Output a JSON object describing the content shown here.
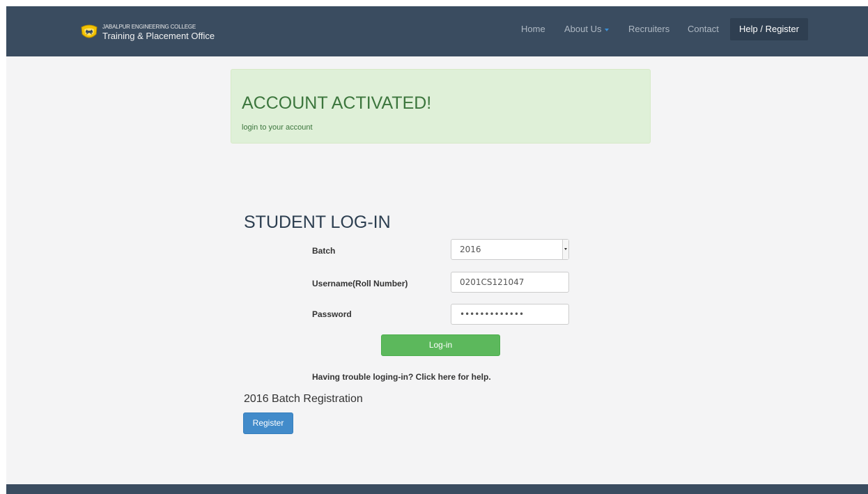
{
  "header": {
    "brand_line1": "JABALPUR ENGINEERING COLLEGE",
    "brand_line2": "Training & Placement Office",
    "logo_icon": "college-crest",
    "nav": {
      "home": "Home",
      "about": "About Us",
      "recruiters": "Recruiters",
      "contact": "Contact",
      "help": "Help / Register"
    }
  },
  "alert": {
    "title": "ACCOUNT ACTIVATED!",
    "subtitle": "login to your account"
  },
  "login": {
    "title": "STUDENT LOG-IN",
    "batch_label": "Batch",
    "batch_value": "2016",
    "username_label": "Username(Roll Number)",
    "username_value": "0201CS121047",
    "password_label": "Password",
    "password_value": "•••••••••••••",
    "login_button": "Log-in",
    "trouble_link": "Having trouble loging-in? Click here for help."
  },
  "registration": {
    "title": "2016 Batch Registration",
    "button": "Register"
  },
  "colors": {
    "navbar": "#3a4c60",
    "alert_bg": "#dff0d8",
    "alert_text": "#3c763d",
    "login_button": "#5cb85c",
    "register_button": "#428bca"
  }
}
